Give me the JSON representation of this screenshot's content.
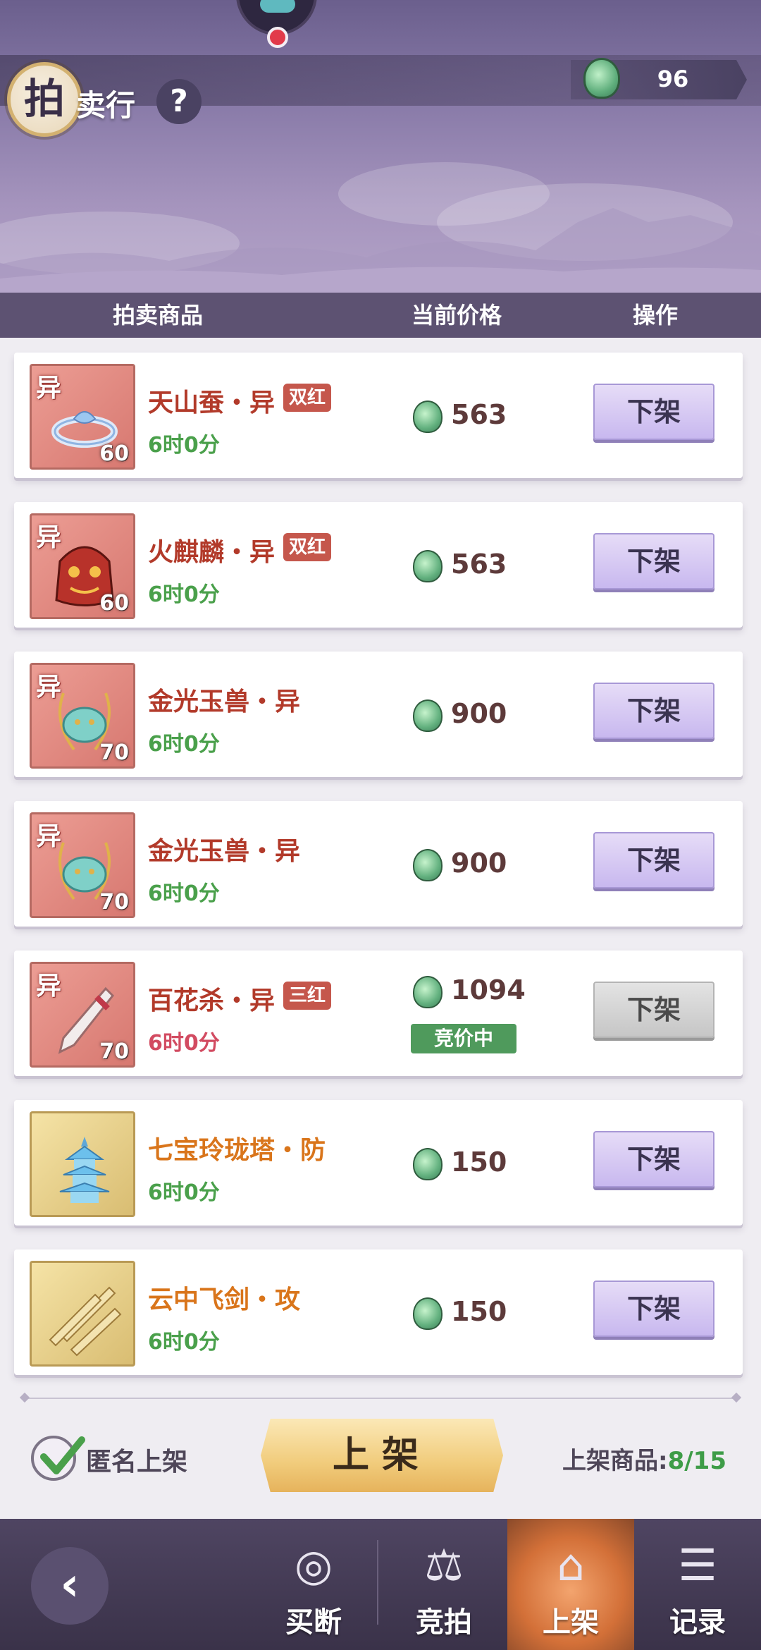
{
  "header": {
    "title_badge": "拍",
    "title_rest": "卖行",
    "help_label": "?",
    "currency_value": "96"
  },
  "columns": {
    "item": "拍卖商品",
    "price": "当前价格",
    "action": "操作"
  },
  "rows": [
    {
      "tag": "异",
      "level": "60",
      "name": "天山蚕・异",
      "badge": "双红",
      "time": "6时0分",
      "price": "563",
      "action": "下架",
      "status": "",
      "frame": "red"
    },
    {
      "tag": "异",
      "level": "60",
      "name": "火麒麟・异",
      "badge": "双红",
      "time": "6时0分",
      "price": "563",
      "action": "下架",
      "status": "",
      "frame": "red"
    },
    {
      "tag": "异",
      "level": "70",
      "name": "金光玉兽・异",
      "badge": "",
      "time": "6时0分",
      "price": "900",
      "action": "下架",
      "status": "",
      "frame": "red"
    },
    {
      "tag": "异",
      "level": "70",
      "name": "金光玉兽・异",
      "badge": "",
      "time": "6时0分",
      "price": "900",
      "action": "下架",
      "status": "",
      "frame": "red"
    },
    {
      "tag": "异",
      "level": "70",
      "name": "百花杀・异",
      "badge": "三红",
      "time": "6时0分",
      "price": "1094",
      "action": "下架",
      "status": "竞价中",
      "frame": "red"
    },
    {
      "tag": "",
      "level": "",
      "name": "七宝玲珑塔・防",
      "badge": "",
      "time": "6时0分",
      "price": "150",
      "action": "下架",
      "status": "",
      "frame": "gold"
    },
    {
      "tag": "",
      "level": "",
      "name": "云中飞剑・攻",
      "badge": "",
      "time": "6时0分",
      "price": "150",
      "action": "下架",
      "status": "",
      "frame": "gold"
    }
  ],
  "footer": {
    "anonymous_label": "匿名上架",
    "anonymous_checked": true,
    "list_button": "上架",
    "count_label": "上架商品:",
    "count_value": "8/15"
  },
  "nav": {
    "back_icon": "back-arrow-icon",
    "items": [
      {
        "label": "买断",
        "icon": "buyout-icon"
      },
      {
        "label": "竞拍",
        "icon": "scale-icon"
      },
      {
        "label": "上架",
        "icon": "shop-icon"
      },
      {
        "label": "记录",
        "icon": "record-icon"
      }
    ]
  },
  "colors": {
    "header_purple": "#887aa8",
    "name_red": "#b23a2a",
    "name_orange": "#d9751b",
    "time_green": "#4aa04b",
    "time_red": "#d24b61",
    "button_lavender": "#c8b8ef",
    "status_green": "#4f9a5c"
  }
}
